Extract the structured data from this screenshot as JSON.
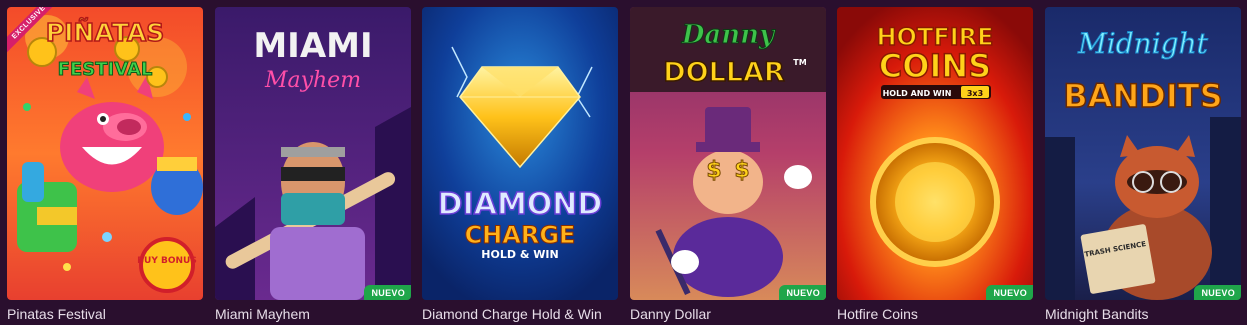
{
  "colors": {
    "page_background": "#2a0f2e",
    "new_badge": "#1fa64a",
    "exclusive_ribbon": "#d61f6a",
    "title_text": "#e7dde8"
  },
  "games": [
    {
      "title": "Pinatas Festival",
      "ribbon": "EXCLUSIVE",
      "logo_line1": "PIÑATAS",
      "logo_line2": "FESTIVAL",
      "extra_badge": "BUY BONUS"
    },
    {
      "title": "Miami Mayhem",
      "logo_line1": "MIAMI",
      "logo_line2": "Mayhem",
      "badge": "NUEVO"
    },
    {
      "title": "Diamond Charge Hold & Win",
      "logo_line1": "DIAMOND",
      "logo_line2": "CHARGE",
      "logo_line3": "HOLD & WIN"
    },
    {
      "title": "Danny Dollar",
      "logo_line1": "Danny",
      "logo_line2": "DOLLAR",
      "logo_tm": "TM",
      "badge": "NUEVO"
    },
    {
      "title": "Hotfire Coins",
      "logo_line1": "HOTFIRE",
      "logo_line2": "COINS",
      "logo_line3": "HOLD AND WIN",
      "logo_line4": "3x3",
      "badge": "NUEVO"
    },
    {
      "title": "Midnight Bandits",
      "logo_line1": "Midnight",
      "logo_line2": "BANDITS",
      "book_text": "TRASH SCIENCE",
      "badge": "NUEVO"
    }
  ]
}
